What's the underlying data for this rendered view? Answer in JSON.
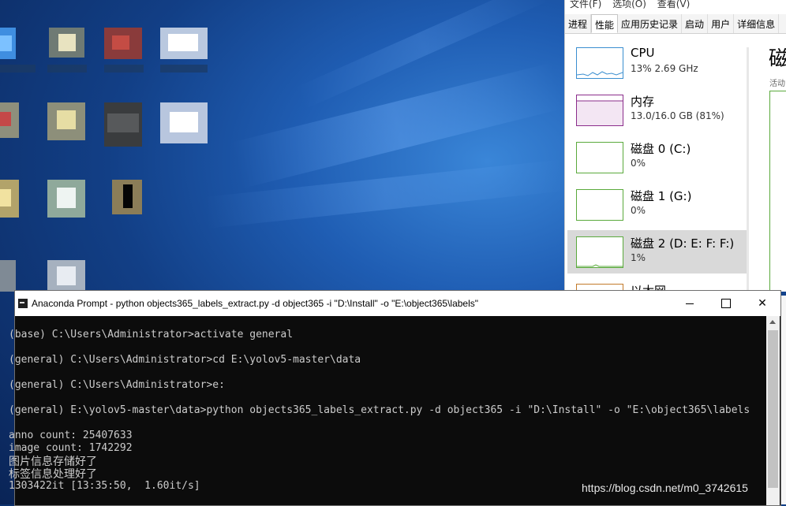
{
  "taskmgr": {
    "menu": [
      "文件(F)",
      "选项(O)",
      "查看(V)"
    ],
    "tabs": [
      {
        "label": "进程",
        "active": false
      },
      {
        "label": "性能",
        "active": true
      },
      {
        "label": "应用历史记录",
        "active": false
      },
      {
        "label": "启动",
        "active": false
      },
      {
        "label": "用户",
        "active": false
      },
      {
        "label": "详细信息",
        "active": false
      }
    ],
    "resources": [
      {
        "name": "CPU",
        "value": "13% 2.69 GHz",
        "selected": false
      },
      {
        "name": "内存",
        "value": "13.0/16.0 GB (81%)",
        "selected": false
      },
      {
        "name": "磁盘 0 (C:)",
        "value": "0%",
        "selected": false
      },
      {
        "name": "磁盘 1 (G:)",
        "value": "0%",
        "selected": false
      },
      {
        "name": "磁盘 2 (D: E: F: F:)",
        "value": "1%",
        "selected": true
      },
      {
        "name": "以太网",
        "value": "",
        "selected": false
      }
    ],
    "detail_title": "磁",
    "detail_sub": "活动"
  },
  "console": {
    "title": "Anaconda Prompt - python  objects365_labels_extract.py -d object365 -i \"D:\\Install\" -o \"E:\\object365\\labels\"",
    "lines": [
      "(base) C:\\Users\\Administrator>activate general",
      "(general) C:\\Users\\Administrator>cd E:\\yolov5-master\\data",
      "(general) C:\\Users\\Administrator>e:",
      "(general) E:\\yolov5-master\\data>python objects365_labels_extract.py -d object365 -i \"D:\\Install\" -o \"E:\\object365\\labels",
      "anno count: 25407633",
      "image count: 1742292",
      "图片信息存储好了",
      "标签信息处理好了",
      "1303422it [13:35:50,  1.60it/s]"
    ]
  },
  "watermark": "https://blog.csdn.net/m0_3742615"
}
